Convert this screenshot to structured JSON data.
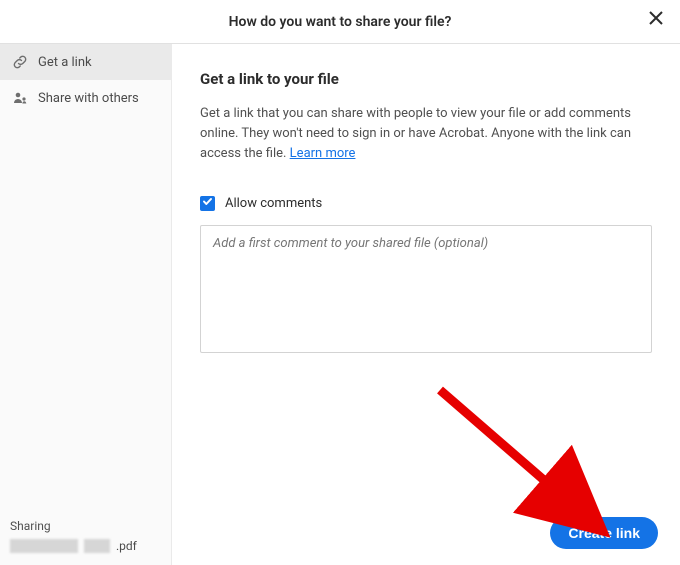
{
  "header": {
    "title": "How do you want to share your file?"
  },
  "sidebar": {
    "items": [
      {
        "label": "Get a link"
      },
      {
        "label": "Share with others"
      }
    ],
    "sharing_label": "Sharing",
    "file_ext": ".pdf"
  },
  "main": {
    "title": "Get a link to your file",
    "description": "Get a link that you can share with people to view your file or add comments online. They won't need to sign in or have Acrobat. Anyone with the link can access the file.",
    "learn_more": "Learn more",
    "allow_comments_label": "Allow comments",
    "comment_placeholder": "Add a first comment to your shared file (optional)",
    "create_button": "Create link"
  }
}
